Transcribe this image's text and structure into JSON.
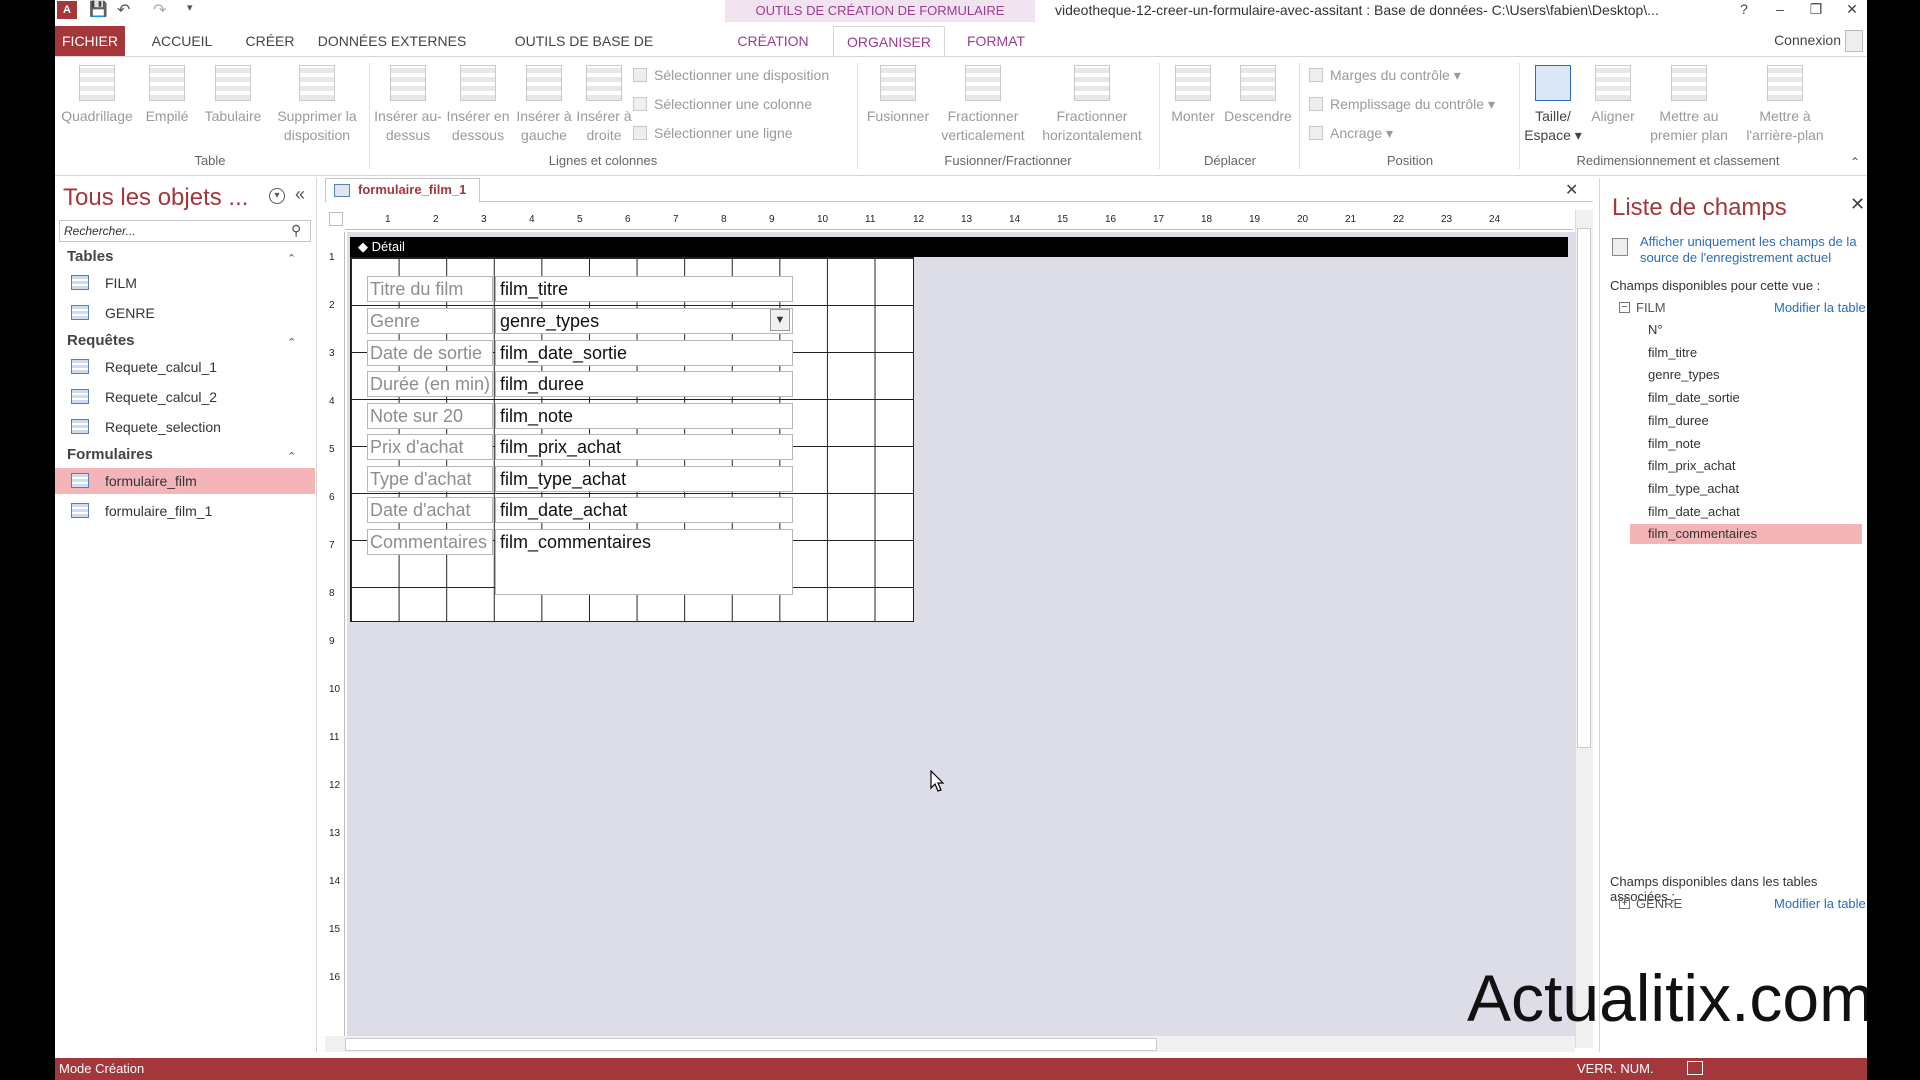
{
  "app": {
    "context_tools": "OUTILS DE CRÉATION DE FORMULAIRE",
    "doc_title": "videotheque-12-creer-un-formulaire-avec-assitant : Base de données- C:\\Users\\fabien\\Desktop\\...",
    "help": "?",
    "minimize": "–",
    "restore": "❐",
    "close": "✕"
  },
  "tabs": [
    {
      "label": "FICHIER"
    },
    {
      "label": "ACCUEIL"
    },
    {
      "label": "CRÉER"
    },
    {
      "label": "DONNÉES EXTERNES"
    },
    {
      "label": "OUTILS DE BASE DE DONNÉES"
    },
    {
      "label": "CRÉATION"
    },
    {
      "label": "ORGANISER"
    },
    {
      "label": "FORMAT"
    }
  ],
  "connexion": "Connexion",
  "ribbon": {
    "table": {
      "name": "Table",
      "buttons": [
        "Quadrillage",
        "Empilé",
        "Tabulaire",
        "Supprimer la disposition"
      ]
    },
    "rows_cols": {
      "name": "Lignes et colonnes",
      "buttons": [
        "Insérer au-dessus",
        "Insérer en dessous",
        "Insérer à gauche",
        "Insérer à droite"
      ],
      "small": [
        "Sélectionner une disposition",
        "Sélectionner une colonne",
        "Sélectionner une ligne"
      ]
    },
    "merge": {
      "name": "Fusionner/Fractionner",
      "buttons": [
        "Fusionner",
        "Fractionner verticalement",
        "Fractionner horizontalement"
      ]
    },
    "move": {
      "name": "Déplacer",
      "buttons": [
        "Monter",
        "Descendre"
      ]
    },
    "position": {
      "name": "Position",
      "small": [
        "Marges du contrôle",
        "Remplissage du contrôle",
        "Ancrage"
      ]
    },
    "resize": {
      "name": "Redimensionnement et classement",
      "buttons": [
        "Taille/ Espace",
        "Aligner",
        "Mettre au premier plan",
        "Mettre à l'arrière-plan"
      ]
    }
  },
  "nav": {
    "title": "Tous les objets ...",
    "search_placeholder": "Rechercher...",
    "groups": [
      {
        "label": "Tables",
        "items": [
          "FILM",
          "GENRE"
        ]
      },
      {
        "label": "Requêtes",
        "items": [
          "Requete_calcul_1",
          "Requete_calcul_2",
          "Requete_selection"
        ]
      },
      {
        "label": "Formulaires",
        "items": [
          "formulaire_film",
          "formulaire_film_1"
        ]
      }
    ],
    "selected_item": "formulaire_film"
  },
  "document": {
    "tab_label": "formulaire_film_1",
    "section_label": "Détail",
    "ruler_h": [
      "1",
      "2",
      "3",
      "4",
      "5",
      "6",
      "7",
      "8",
      "9",
      "10",
      "11",
      "12",
      "13",
      "14",
      "15",
      "16",
      "17",
      "18",
      "19",
      "20",
      "21",
      "22",
      "23",
      "24"
    ],
    "ruler_v": [
      "1",
      "2",
      "3",
      "4",
      "5",
      "6",
      "7",
      "8",
      "9",
      "10",
      "11",
      "12",
      "13",
      "14",
      "15",
      "16"
    ],
    "rows": [
      {
        "label": "Titre du film",
        "field": "film_titre"
      },
      {
        "label": "Genre",
        "field": "genre_types"
      },
      {
        "label": "Date de sortie",
        "field": "film_date_sortie"
      },
      {
        "label": "Durée (en min)",
        "field": "film_duree"
      },
      {
        "label": "Note sur 20",
        "field": "film_note"
      },
      {
        "label": "Prix d'achat",
        "field": "film_prix_achat"
      },
      {
        "label": "Type d'achat",
        "field": "film_type_achat"
      },
      {
        "label": "Date d'achat",
        "field": "film_date_achat"
      },
      {
        "label": "Commentaires",
        "field": "film_commentaires"
      }
    ]
  },
  "fieldlist": {
    "title": "Liste de champs",
    "show_only_link": "Afficher uniquement les champs de la source de l'enregistrement actuel",
    "available_label": "Champs disponibles pour cette vue :",
    "edit_table": "Modifier la table",
    "table": "FILM",
    "fields": [
      "N°",
      "film_titre",
      "genre_types",
      "film_date_sortie",
      "film_duree",
      "film_note",
      "film_prix_achat",
      "film_type_achat",
      "film_date_achat",
      "film_commentaires"
    ],
    "selected_field": "film_commentaires",
    "related_label": "Champs disponibles dans les tables associées :",
    "related_table": "GENRE",
    "related_edit": "Modifier la table"
  },
  "watermark": "Actualitix.com",
  "status": {
    "left": "Mode Création",
    "right": "VERR. NUM."
  },
  "colors": {
    "accent": "#a4373a",
    "context": "#9b3c8f",
    "selection": "#f4b5b8",
    "link": "#2a6cbb"
  }
}
